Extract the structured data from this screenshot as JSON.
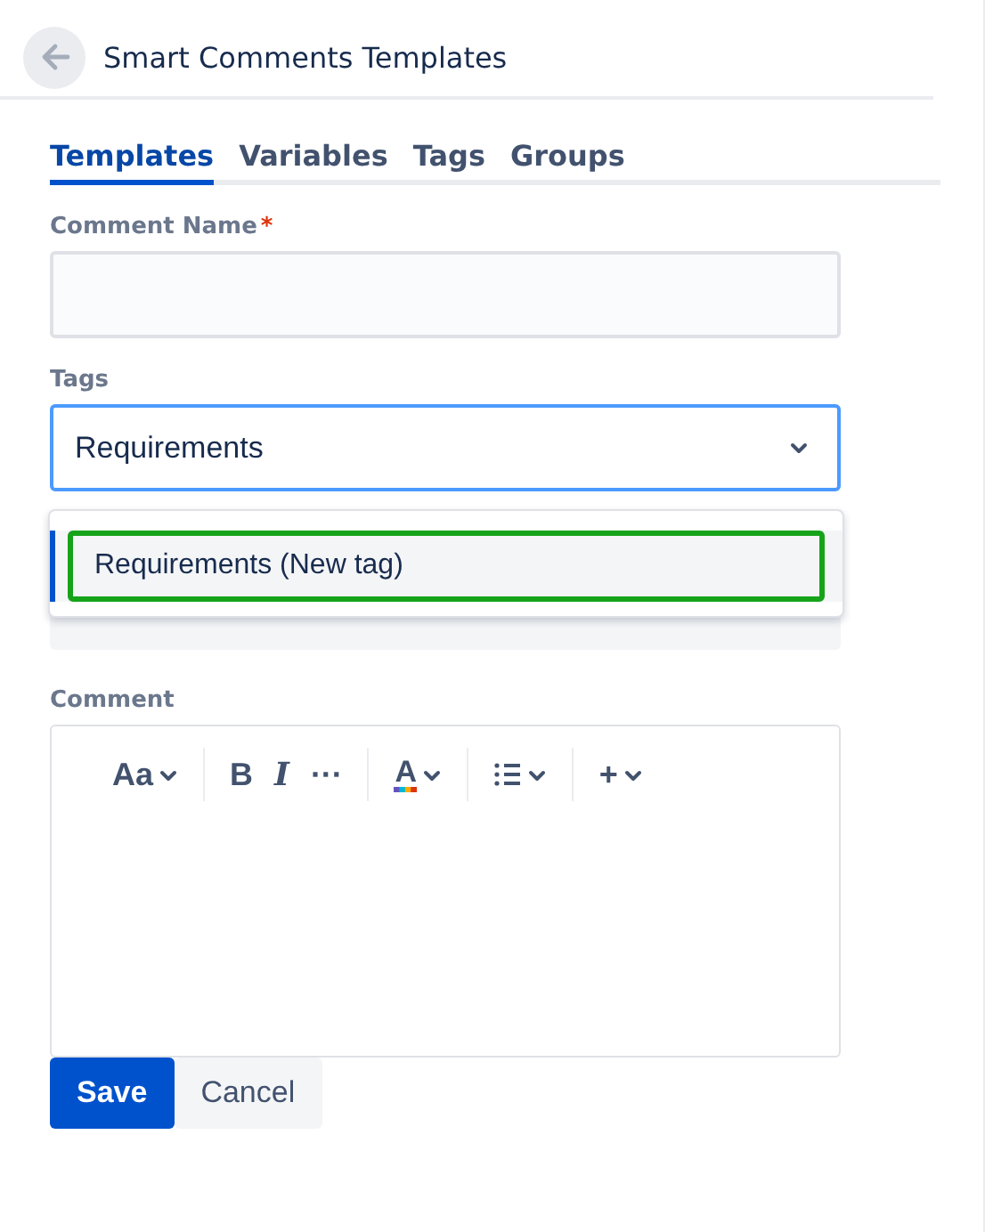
{
  "header": {
    "title": "Smart Comments Templates"
  },
  "tabs": [
    {
      "label": "Templates",
      "selected": true
    },
    {
      "label": "Variables",
      "selected": false
    },
    {
      "label": "Tags",
      "selected": false
    },
    {
      "label": "Groups",
      "selected": false
    }
  ],
  "comment_name": {
    "label": "Comment Name",
    "required_mark": "*"
  },
  "tags": {
    "label": "Tags",
    "value": "Requirements",
    "expanded": true,
    "options": [
      {
        "label": "Requirements (New tag)",
        "selected": true
      }
    ]
  },
  "comment": {
    "label": "Comment",
    "toolbar": [
      [
        {
          "kind": "text",
          "label": "Aa",
          "caret": true
        }
      ],
      [
        {
          "kind": "bold",
          "label": "B",
          "caret": false
        },
        {
          "kind": "italic",
          "label": "I",
          "caret": false
        },
        {
          "kind": "text",
          "label": "···",
          "caret": false
        }
      ],
      [
        {
          "kind": "color",
          "label": "A",
          "caret": true
        }
      ],
      [
        {
          "kind": "list",
          "caret": true
        }
      ],
      [
        {
          "kind": "text",
          "label": "+",
          "caret": true
        }
      ]
    ]
  },
  "buttons": [
    {
      "label": "Save",
      "kind": "primary"
    },
    {
      "label": "Cancel",
      "kind": "subtle"
    }
  ]
}
